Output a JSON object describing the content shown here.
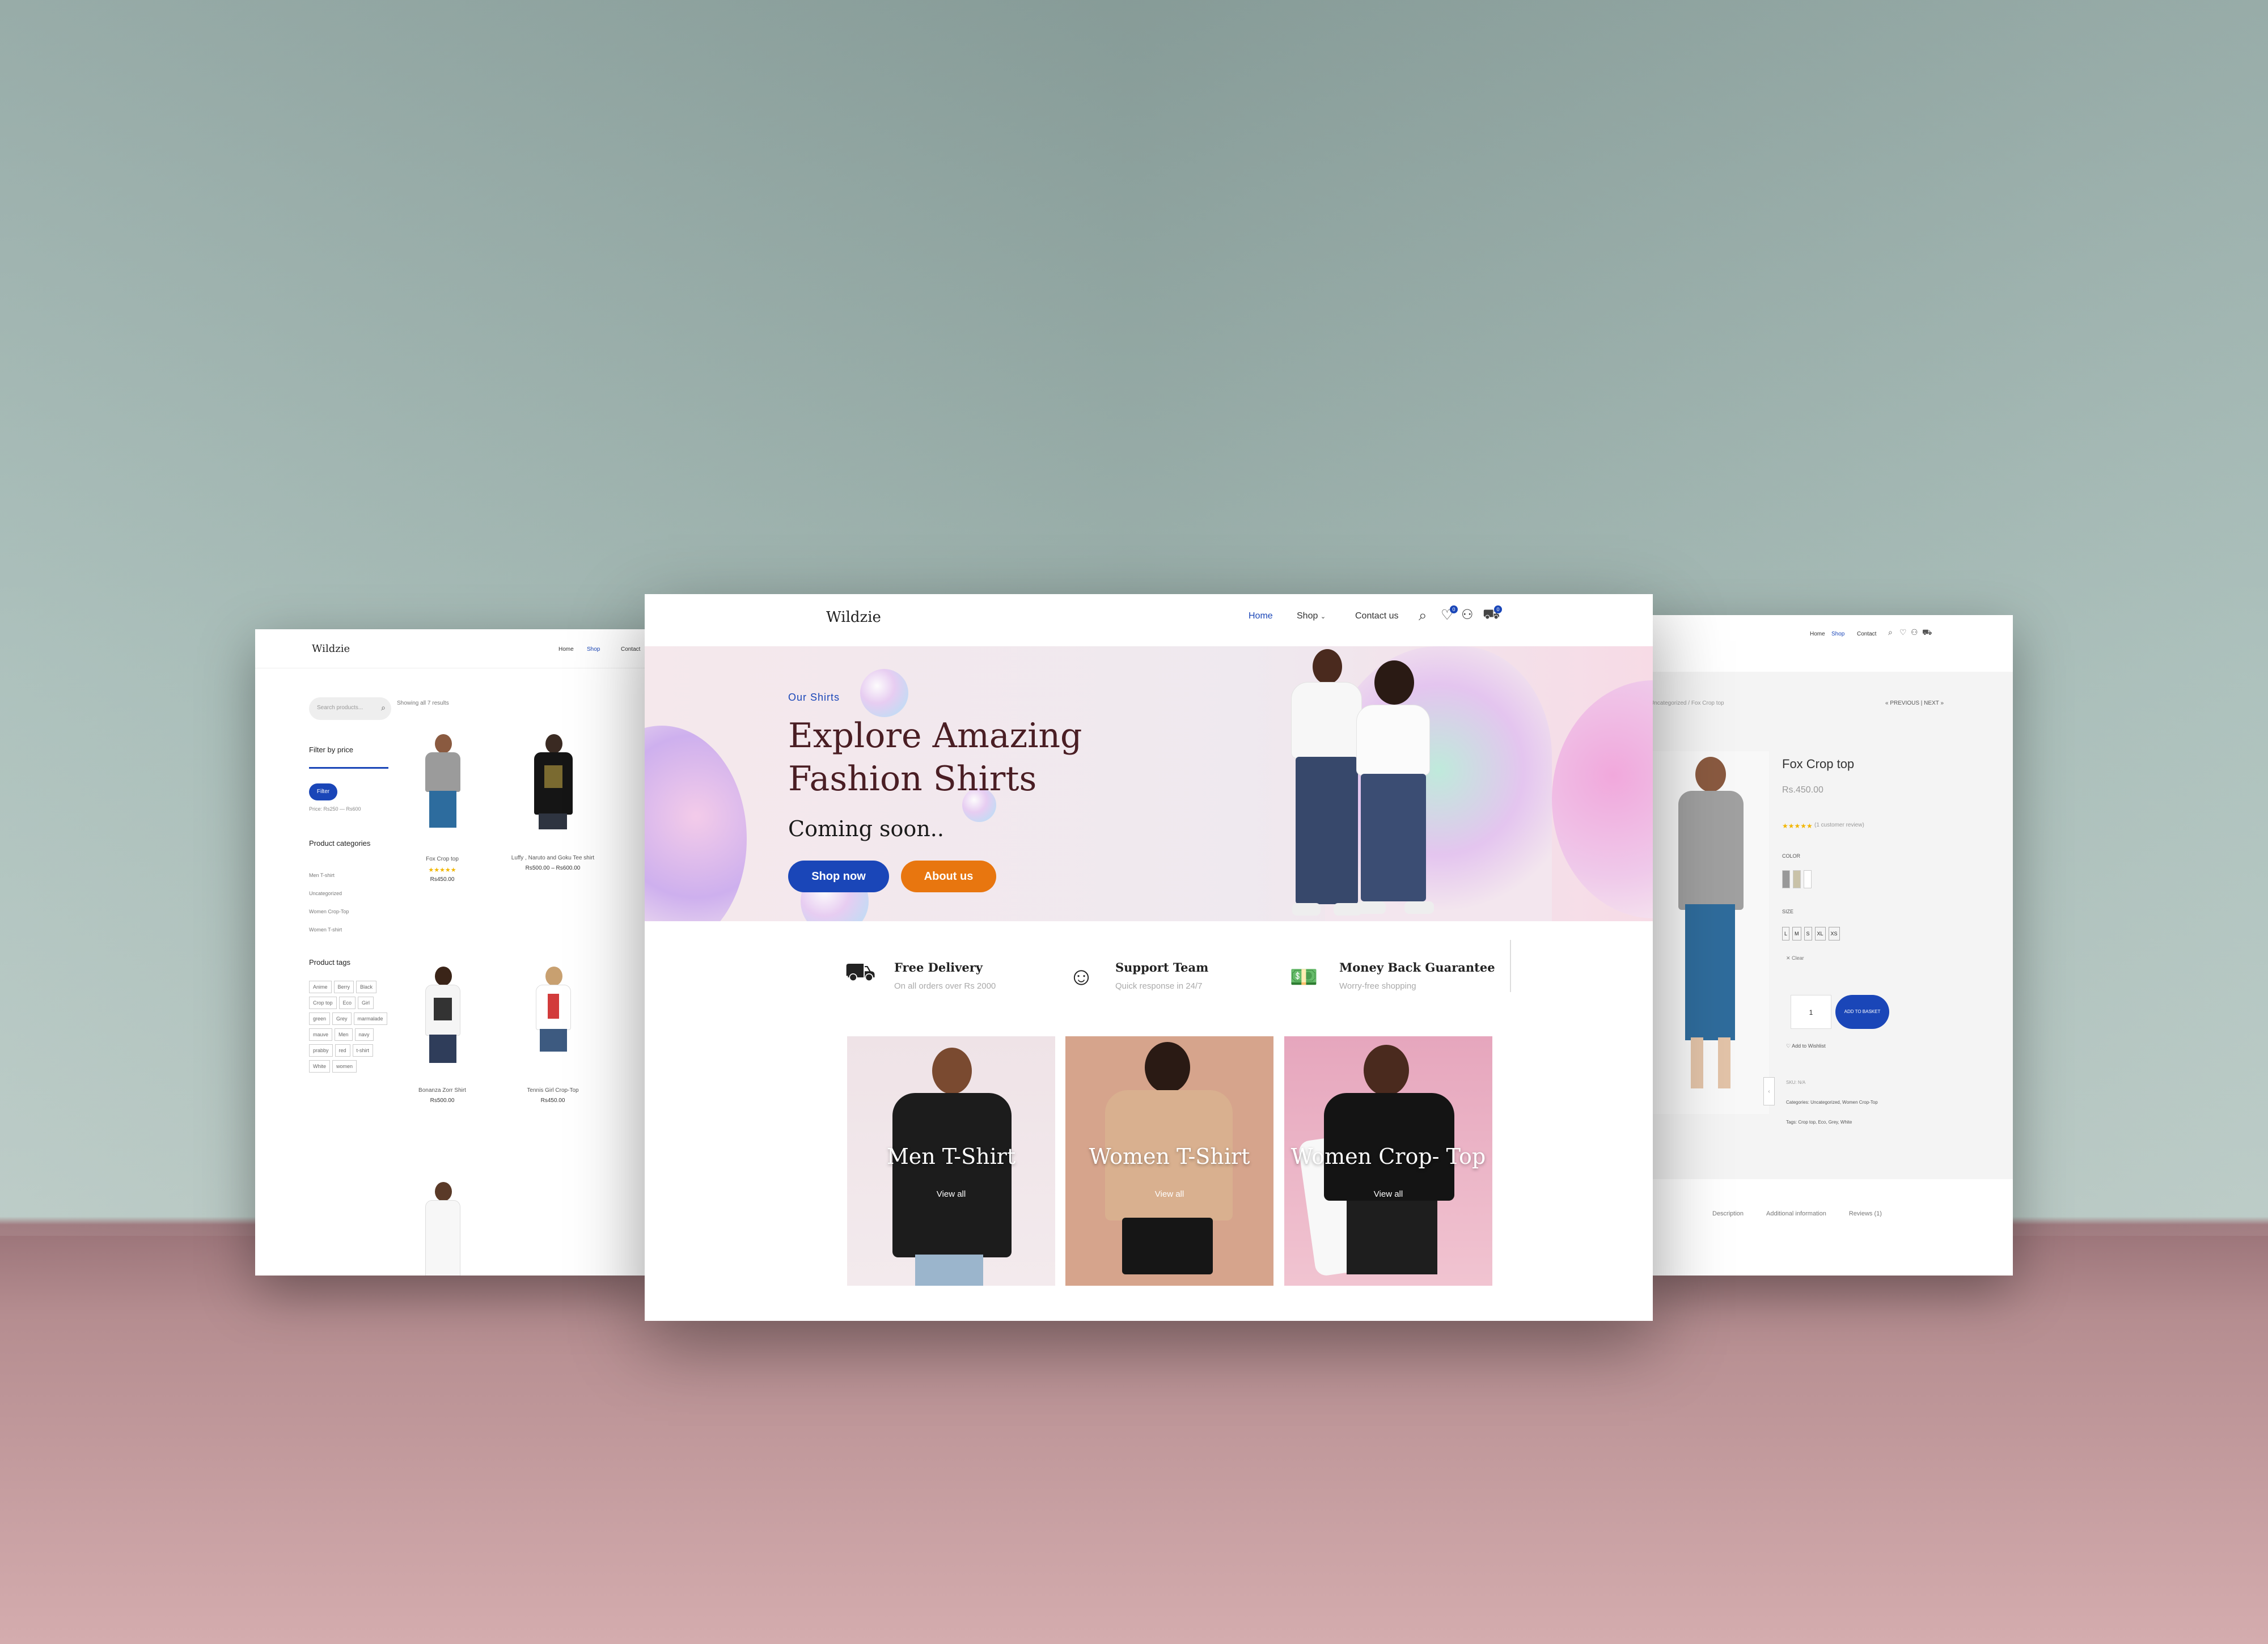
{
  "left_page": {
    "logo": "Wildzie",
    "nav": [
      "Home",
      "Shop",
      "Contact"
    ],
    "search_placeholder": "Search products...",
    "showing": "Showing all 7 results",
    "filter_title": "Filter by price",
    "filter_button": "Filter",
    "price_range": "Price: Rs250 — Rs600",
    "categories_title": "Product categories",
    "categories": [
      "Men T-shirt",
      "Uncategorized",
      "Women Crop-Top",
      "Women T-shirt"
    ],
    "tags_title": "Product tags",
    "tags": [
      "Anime",
      "Berry",
      "Black",
      "Crop top",
      "Eco",
      "Girl",
      "green",
      "Grey",
      "marmalade",
      "mauve",
      "Men",
      "navy",
      "prabby",
      "red",
      "t-shirt",
      "White",
      "women"
    ],
    "products": [
      {
        "name": "Fox Crop top",
        "price": "Rs450.00"
      },
      {
        "name": "Luffy , Naruto and Goku Tee shirt",
        "price": "Rs500.00 – Rs600.00"
      },
      {
        "name": "Bonanza Zorr Shirt",
        "price": "Rs500.00"
      },
      {
        "name": "Tennis Girl Crop-Top",
        "price": "Rs450.00"
      }
    ]
  },
  "main_page": {
    "logo": "Wildzie",
    "nav": {
      "home": "Home",
      "shop": "Shop",
      "contact": "Contact us"
    },
    "wishlist_count": "0",
    "cart_count": "0",
    "hero": {
      "eyebrow": "Our Shirts",
      "title_line1": "Explore Amazing",
      "title_line2": "Fashion Shirts",
      "subtitle": "Coming soon..",
      "shop_button": "Shop now",
      "about_button": "About us"
    },
    "features": [
      {
        "icon": "delivery-truck-icon",
        "title": "Free Delivery",
        "sub": "On all orders over Rs 2000"
      },
      {
        "icon": "support-agent-icon",
        "title": "Support Team",
        "sub": "Quick response in 24/7"
      },
      {
        "icon": "money-back-icon",
        "title": "Money Back Guarantee",
        "sub": "Worry-free shopping"
      }
    ],
    "categories": [
      {
        "label": "Men T-Shirt",
        "link": "View all"
      },
      {
        "label": "Women T-Shirt",
        "link": "View all"
      },
      {
        "label": "Women Crop- Top",
        "link": "View all"
      }
    ]
  },
  "right_page": {
    "nav": [
      "Home",
      "Shop",
      "Contact"
    ],
    "breadcrumb": "Uncategorized / Fox Crop top",
    "prev_next": "« PREVIOUS | NEXT »",
    "product_name": "Fox Crop top",
    "price": "Rs.450.00",
    "reviews": "(1 customer review)",
    "color_label": "COLOR",
    "size_label": "SIZE",
    "sizes": [
      "L",
      "M",
      "S",
      "XL",
      "XS"
    ],
    "clear": "Clear",
    "qty": "1",
    "add_to_basket": "ADD TO BASKET",
    "wishlist": "Add to Wishlist",
    "sku": "SKU: N/A",
    "categories_line": "Categories: Uncategorized, Women Crop-Top",
    "tags_line": "Tags: Crop top, Eco, Grey, White",
    "tabs": [
      "Description",
      "Additional information",
      "Reviews (1)"
    ]
  },
  "colors": {
    "accent_blue": "#1a46b8",
    "accent_orange": "#e8760f",
    "hero_title": "#4a1e24"
  }
}
